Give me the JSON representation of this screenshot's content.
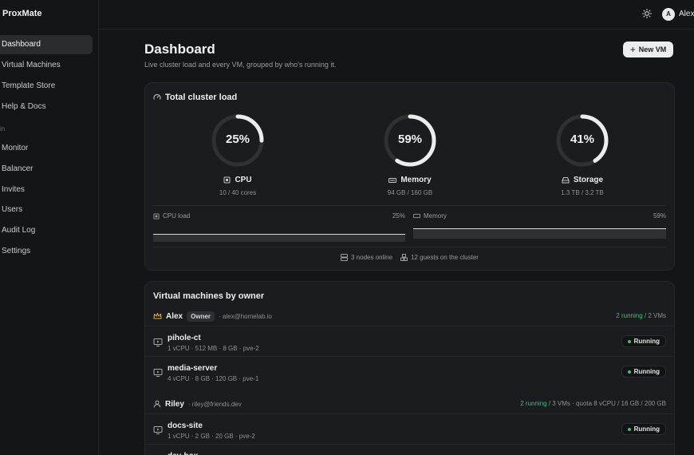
{
  "app": {
    "brand": "ProxMate"
  },
  "sidebar": {
    "items": [
      {
        "label": "Dashboard",
        "active": true
      },
      {
        "label": "Virtual Machines"
      },
      {
        "label": "Template Store"
      },
      {
        "label": "Help & Docs"
      }
    ],
    "admin_group_label": "in",
    "admin_items": [
      {
        "label": "Monitor"
      },
      {
        "label": "Balancer"
      },
      {
        "label": "Invites"
      },
      {
        "label": "Users"
      },
      {
        "label": "Audit Log"
      },
      {
        "label": "Settings"
      }
    ]
  },
  "topbar": {
    "avatar_initial": "A",
    "user_name": "Alex",
    "theme_icon": "sun-icon"
  },
  "page": {
    "title": "Dashboard",
    "subtitle": "Live cluster load and every VM, grouped by who's running it.",
    "new_vm_label": "New VM"
  },
  "cluster": {
    "title": "Total cluster load",
    "metrics": [
      {
        "label": "CPU",
        "value": "25%",
        "fraction": 0.25,
        "sub": "10 / 40 cores",
        "icon": "cpu-icon"
      },
      {
        "label": "Memory",
        "value": "59%",
        "fraction": 0.59,
        "sub": "94 GB / 160 GB",
        "icon": "memory-icon"
      },
      {
        "label": "Storage",
        "value": "41%",
        "fraction": 0.41,
        "sub": "1.3 TB / 3.2 TB",
        "icon": "storage-icon"
      }
    ],
    "spark_cpu": {
      "label": "CPU load",
      "value": "25%"
    },
    "spark_mem": {
      "label": "Memory",
      "value": "59%"
    },
    "nodes_online": "3 nodes online",
    "guests": "12 guests on the cluster"
  },
  "vms": {
    "title": "Virtual machines by owner",
    "owners": [
      {
        "name": "Alex",
        "badge": "Owner",
        "email": "· alex@homelab.io",
        "running": "2 running",
        "rest": " / 2 VMs",
        "vms": [
          {
            "name": "pihole-ct",
            "specs": "1 vCPU · 512 MB · 8 GB · pve-2",
            "status": "Running"
          },
          {
            "name": "media-server",
            "specs": "4 vCPU · 8 GB · 120 GB · pve-1",
            "status": "Running"
          }
        ]
      },
      {
        "name": "Riley",
        "email": "· riley@friends.dev",
        "running": "2 running",
        "rest": " / 3 VMs · quota 8 vCPU / 16 GB / 200 GB",
        "vms": [
          {
            "name": "docs-site",
            "specs": "1 vCPU · 2 GB · 20 GB · pve-2",
            "status": "Running"
          },
          {
            "name": "dev-box",
            "specs": "",
            "status": ""
          }
        ]
      }
    ]
  }
}
